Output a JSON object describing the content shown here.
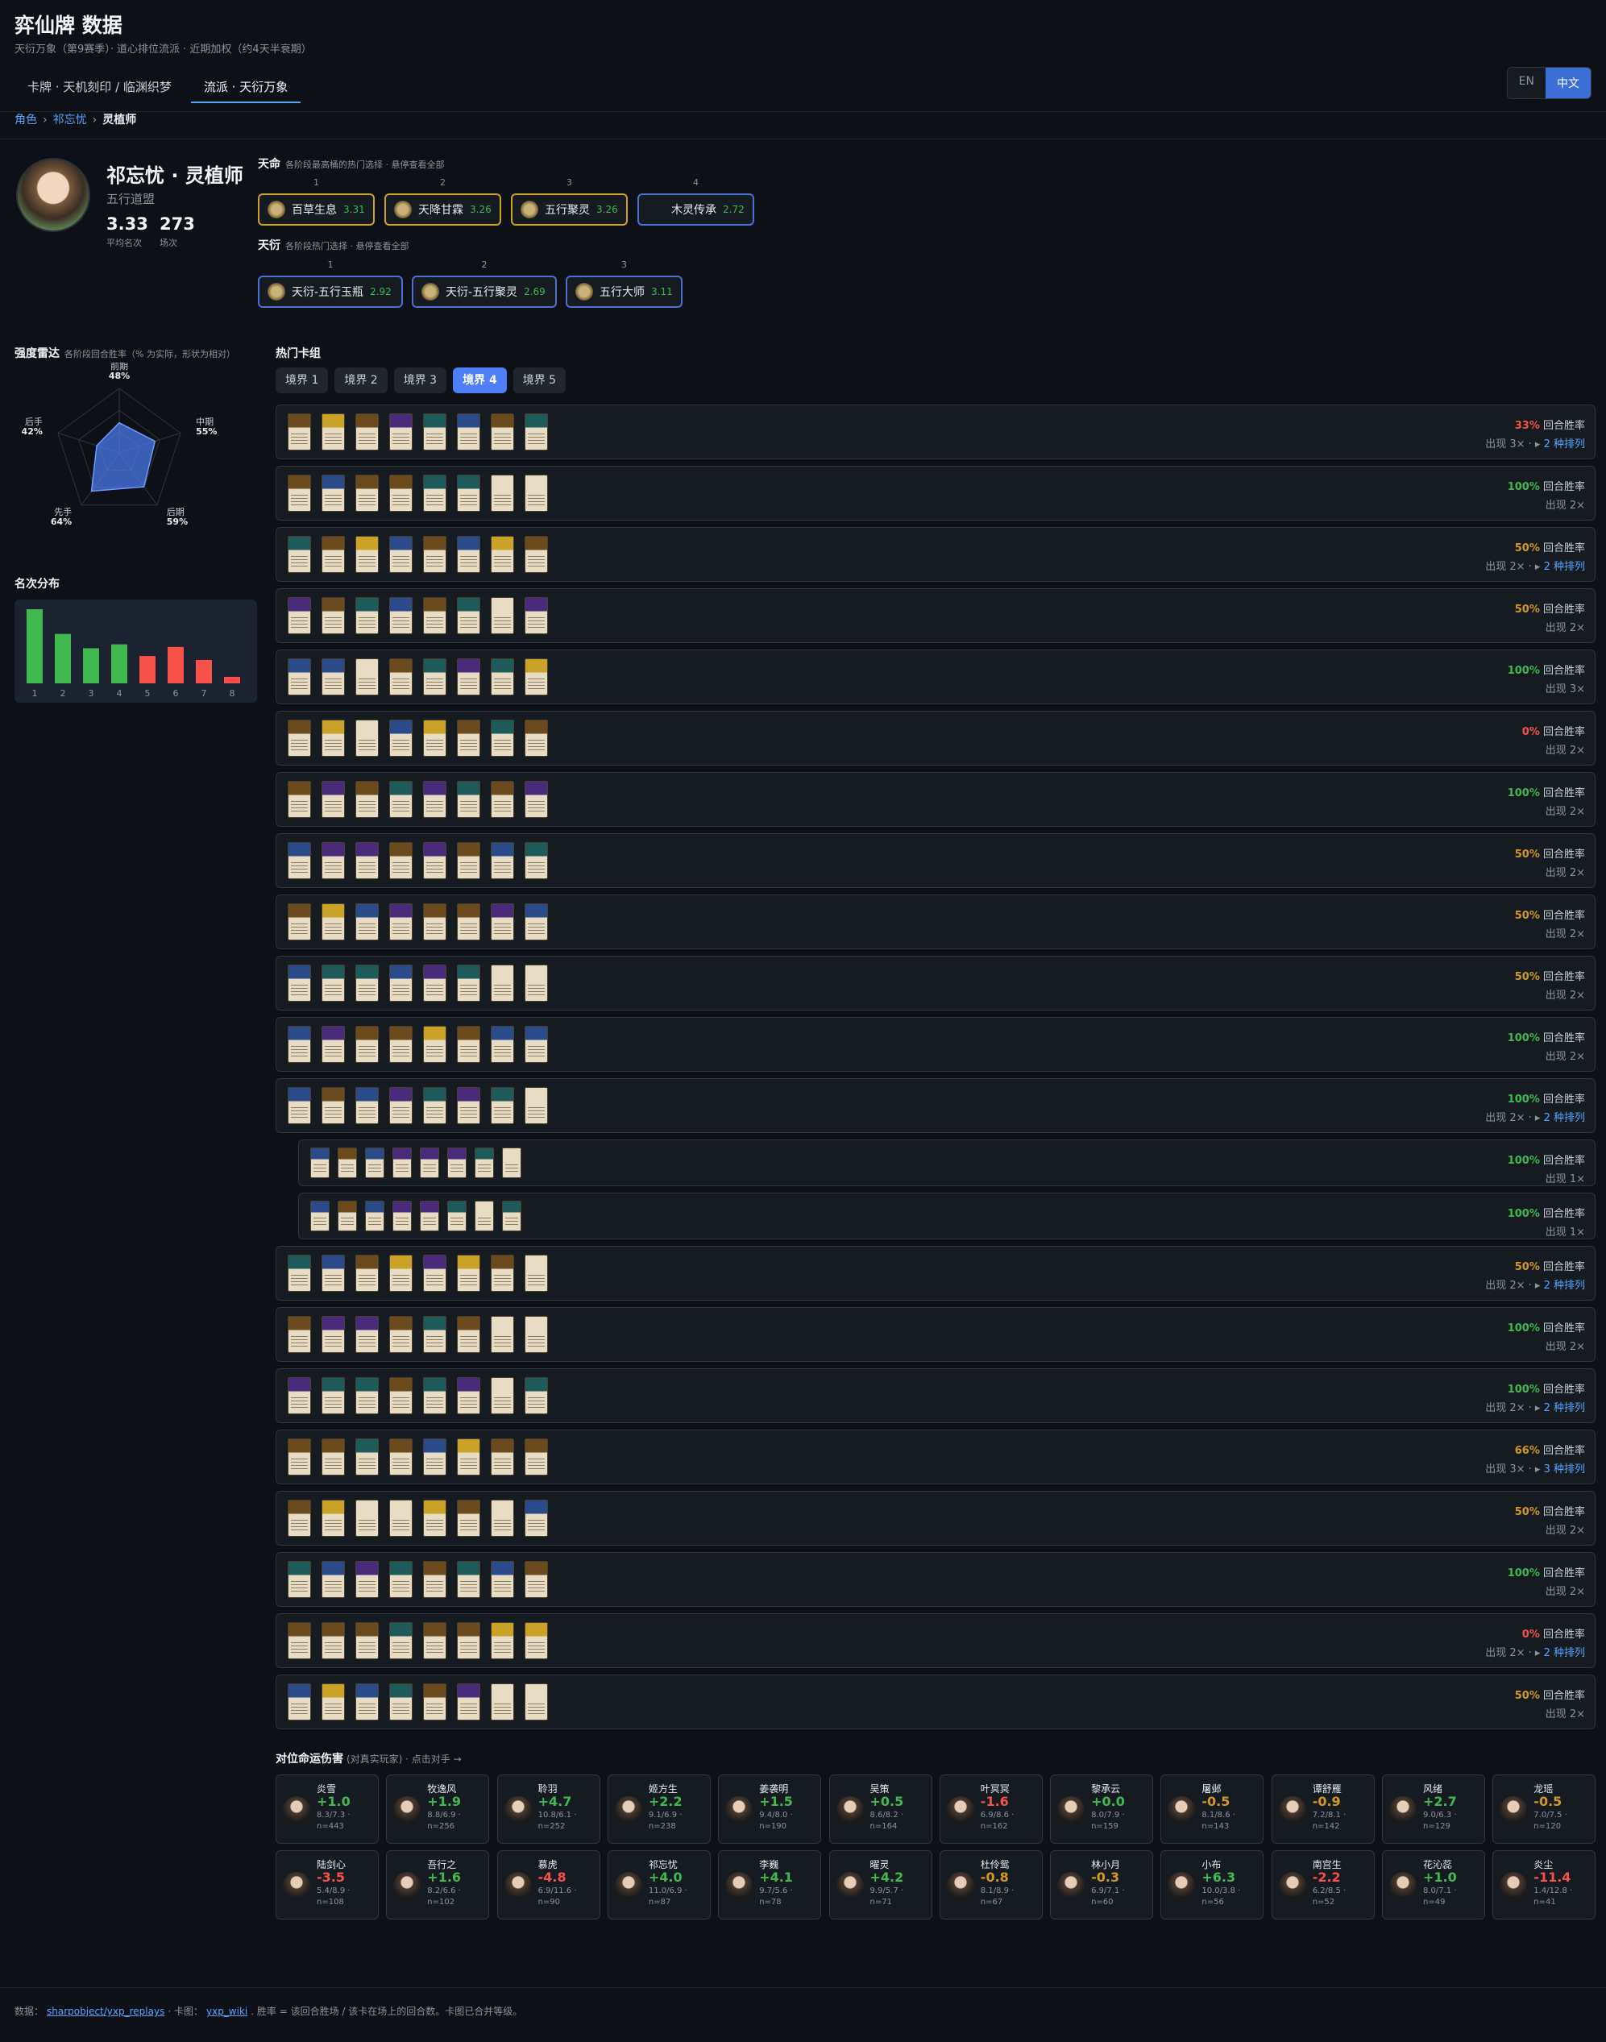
{
  "app": {
    "title": "弈仙牌 数据",
    "subtitle": "天衍万象（第9赛季）· 道心排位流派 · 近期加权（约4天半衰期）"
  },
  "nav": {
    "tabs": [
      "卡牌 · 天机刻印 / 临渊织梦",
      "流派 · 天衍万象"
    ],
    "active_tab": 1,
    "lang": [
      "EN",
      "中文"
    ],
    "lang_active": 1
  },
  "breadcrumb": {
    "root": "角色",
    "parent": "祁忘忧",
    "current": "灵植师"
  },
  "profile": {
    "name": "祁忘忧 · 灵植师",
    "faction": "五行道盟",
    "avg_rank": "3.33",
    "avg_rank_label": "平均名次",
    "games": "273",
    "games_label": "场次"
  },
  "destiny": {
    "title": "天命",
    "note": "各阶段最高桶的热门选择 · 悬停查看全部",
    "items": [
      {
        "rank": "1",
        "name": "百草生息",
        "score": "3.31"
      },
      {
        "rank": "2",
        "name": "天降甘霖",
        "score": "3.26"
      },
      {
        "rank": "3",
        "name": "五行聚灵",
        "score": "3.26"
      },
      {
        "rank": "4",
        "name": "木灵传承",
        "score": "2.72"
      }
    ]
  },
  "tianyan": {
    "title": "天衍",
    "note": "各阶段热门选择 · 悬停查看全部",
    "items": [
      {
        "rank": "1",
        "name": "天衍-五行玉瓶",
        "score": "2.92"
      },
      {
        "rank": "2",
        "name": "天衍-五行聚灵",
        "score": "2.69"
      },
      {
        "rank": "3",
        "name": "五行大师",
        "score": "3.11"
      }
    ]
  },
  "radar": {
    "title": "强度雷达",
    "note": "各阶段回合胜率（% 为实际，形状为相对）",
    "axes": [
      {
        "label": "前期",
        "value": "48%",
        "v": 48
      },
      {
        "label": "中期",
        "value": "55%",
        "v": 55
      },
      {
        "label": "后期",
        "value": "59%",
        "v": 59
      },
      {
        "label": "先手",
        "value": "64%",
        "v": 64
      },
      {
        "label": "后手",
        "value": "42%",
        "v": 42
      }
    ]
  },
  "placement": {
    "title": "名次分布",
    "ranks": [
      "1",
      "2",
      "3",
      "4",
      "5",
      "6",
      "7",
      "8"
    ],
    "values": [
      57,
      38,
      27,
      30,
      21,
      28,
      18,
      5
    ],
    "colors": [
      "#3fb950",
      "#3fb950",
      "#3fb950",
      "#3fb950",
      "#f85149",
      "#f85149",
      "#f85149",
      "#f85149"
    ]
  },
  "decks": {
    "title": "热门卡组",
    "realm_tabs": [
      "境界 1",
      "境界 2",
      "境界 3",
      "境界 4",
      "境界 5"
    ],
    "active_realm": 3,
    "wr_label": "回合胜率",
    "rows": [
      {
        "pct": "33%",
        "tone": "lo",
        "appear": "出现 3×",
        "perm": "2 种排列",
        "cards": [
          1,
          6,
          1,
          3,
          2,
          4,
          1,
          2
        ]
      },
      {
        "pct": "100%",
        "tone": "hi",
        "appear": "出现 2×",
        "perm": "",
        "cards": [
          1,
          4,
          1,
          1,
          2,
          2,
          5,
          5
        ]
      },
      {
        "pct": "50%",
        "tone": "md",
        "appear": "出现 2×",
        "perm": "2 种排列",
        "cards": [
          2,
          1,
          6,
          4,
          1,
          4,
          6,
          1
        ]
      },
      {
        "pct": "50%",
        "tone": "md",
        "appear": "出现 2×",
        "perm": "",
        "cards": [
          3,
          1,
          2,
          4,
          1,
          2,
          5,
          3
        ]
      },
      {
        "pct": "100%",
        "tone": "hi",
        "appear": "出现 3×",
        "perm": "",
        "cards": [
          4,
          4,
          5,
          1,
          2,
          3,
          2,
          6
        ]
      },
      {
        "pct": "0%",
        "tone": "lo",
        "appear": "出现 2×",
        "perm": "",
        "cards": [
          1,
          6,
          5,
          4,
          6,
          1,
          2,
          1
        ]
      },
      {
        "pct": "100%",
        "tone": "hi",
        "appear": "出现 2×",
        "perm": "",
        "cards": [
          1,
          3,
          1,
          2,
          3,
          2,
          1,
          3
        ]
      },
      {
        "pct": "50%",
        "tone": "md",
        "appear": "出现 2×",
        "perm": "",
        "cards": [
          4,
          3,
          3,
          1,
          3,
          1,
          4,
          2
        ]
      },
      {
        "pct": "50%",
        "tone": "md",
        "appear": "出现 2×",
        "perm": "",
        "cards": [
          1,
          6,
          4,
          3,
          1,
          1,
          3,
          4
        ]
      },
      {
        "pct": "50%",
        "tone": "md",
        "appear": "出现 2×",
        "perm": "",
        "cards": [
          4,
          2,
          2,
          4,
          3,
          2,
          5,
          5
        ]
      },
      {
        "pct": "100%",
        "tone": "hi",
        "appear": "出现 2×",
        "perm": "",
        "cards": [
          4,
          3,
          1,
          1,
          6,
          1,
          4,
          4
        ]
      },
      {
        "pct": "100%",
        "tone": "hi",
        "appear": "出现 2×",
        "perm": "2 种排列",
        "cards": [
          4,
          1,
          4,
          3,
          2,
          3,
          2,
          5
        ]
      },
      {
        "pct": "100%",
        "tone": "hi",
        "appear": "出现 1×",
        "perm": "",
        "sub": true,
        "cards": [
          4,
          1,
          4,
          3,
          3,
          3,
          2,
          5
        ]
      },
      {
        "pct": "100%",
        "tone": "hi",
        "appear": "出现 1×",
        "perm": "",
        "sub": true,
        "cards": [
          4,
          1,
          4,
          3,
          3,
          2,
          5,
          2
        ]
      },
      {
        "pct": "50%",
        "tone": "md",
        "appear": "出现 2×",
        "perm": "2 种排列",
        "cards": [
          2,
          4,
          1,
          6,
          3,
          6,
          1,
          5
        ]
      },
      {
        "pct": "100%",
        "tone": "hi",
        "appear": "出现 2×",
        "perm": "",
        "cards": [
          1,
          3,
          3,
          1,
          2,
          1,
          5,
          5
        ]
      },
      {
        "pct": "100%",
        "tone": "hi",
        "appear": "出现 2×",
        "perm": "2 种排列",
        "cards": [
          3,
          2,
          2,
          1,
          2,
          3,
          5,
          2
        ]
      },
      {
        "pct": "66%",
        "tone": "md",
        "appear": "出现 3×",
        "perm": "3 种排列",
        "cards": [
          1,
          1,
          2,
          1,
          4,
          6,
          1,
          1
        ]
      },
      {
        "pct": "50%",
        "tone": "md",
        "appear": "出现 2×",
        "perm": "",
        "cards": [
          1,
          6,
          5,
          5,
          6,
          1,
          5,
          4
        ]
      },
      {
        "pct": "100%",
        "tone": "hi",
        "appear": "出现 2×",
        "perm": "",
        "cards": [
          2,
          4,
          3,
          2,
          1,
          2,
          4,
          1
        ]
      },
      {
        "pct": "0%",
        "tone": "lo",
        "appear": "出现 2×",
        "perm": "2 种排列",
        "cards": [
          1,
          1,
          1,
          2,
          1,
          1,
          6,
          6
        ]
      },
      {
        "pct": "50%",
        "tone": "md",
        "appear": "出现 2×",
        "perm": "",
        "cards": [
          4,
          6,
          4,
          2,
          1,
          3,
          5,
          5
        ]
      }
    ]
  },
  "matchups": {
    "title": "对位命运伤害",
    "note": "(对真实玩家) · 点击对手 →",
    "items": [
      {
        "name": "炎雪",
        "delta": "+1.0",
        "tone": "hi",
        "detail": "8.3/7.3 ·",
        "n": "n=443"
      },
      {
        "name": "牧逸风",
        "delta": "+1.9",
        "tone": "hi",
        "detail": "8.8/6.9 ·",
        "n": "n=256"
      },
      {
        "name": "聆羽",
        "delta": "+4.7",
        "tone": "hi",
        "detail": "10.8/6.1 ·",
        "n": "n=252"
      },
      {
        "name": "姬方生",
        "delta": "+2.2",
        "tone": "hi",
        "detail": "9.1/6.9 ·",
        "n": "n=238"
      },
      {
        "name": "姜袭明",
        "delta": "+1.5",
        "tone": "hi",
        "detail": "9.4/8.0 ·",
        "n": "n=190"
      },
      {
        "name": "吴策",
        "delta": "+0.5",
        "tone": "hi",
        "detail": "8.6/8.2 ·",
        "n": "n=164"
      },
      {
        "name": "叶冥冥",
        "delta": "-1.6",
        "tone": "lo",
        "detail": "6.9/8.6 ·",
        "n": "n=162"
      },
      {
        "name": "黎承云",
        "delta": "+0.0",
        "tone": "hi",
        "detail": "8.0/7.9 ·",
        "n": "n=159"
      },
      {
        "name": "屠邺",
        "delta": "-0.5",
        "tone": "md",
        "detail": "8.1/8.6 ·",
        "n": "n=143"
      },
      {
        "name": "谭舒雁",
        "delta": "-0.9",
        "tone": "md",
        "detail": "7.2/8.1 ·",
        "n": "n=142"
      },
      {
        "name": "风绪",
        "delta": "+2.7",
        "tone": "hi",
        "detail": "9.0/6.3 ·",
        "n": "n=129"
      },
      {
        "name": "龙瑶",
        "delta": "-0.5",
        "tone": "md",
        "detail": "7.0/7.5 ·",
        "n": "n=120"
      },
      {
        "name": "陆剑心",
        "delta": "-3.5",
        "tone": "lo",
        "detail": "5.4/8.9 ·",
        "n": "n=108"
      },
      {
        "name": "吾行之",
        "delta": "+1.6",
        "tone": "hi",
        "detail": "8.2/6.6 ·",
        "n": "n=102"
      },
      {
        "name": "慕虎",
        "delta": "-4.8",
        "tone": "lo",
        "detail": "6.9/11.6 ·",
        "n": "n=90"
      },
      {
        "name": "祁忘忧",
        "delta": "+4.0",
        "tone": "hi",
        "detail": "11.0/6.9 ·",
        "n": "n=87"
      },
      {
        "name": "李巍",
        "delta": "+4.1",
        "tone": "hi",
        "detail": "9.7/5.6 ·",
        "n": "n=78"
      },
      {
        "name": "曜灵",
        "delta": "+4.2",
        "tone": "hi",
        "detail": "9.9/5.7 ·",
        "n": "n=71"
      },
      {
        "name": "杜伶鸳",
        "delta": "-0.8",
        "tone": "md",
        "detail": "8.1/8.9 ·",
        "n": "n=67"
      },
      {
        "name": "林小月",
        "delta": "-0.3",
        "tone": "md",
        "detail": "6.9/7.1 ·",
        "n": "n=60"
      },
      {
        "name": "小布",
        "delta": "+6.3",
        "tone": "hi",
        "detail": "10.0/3.8 ·",
        "n": "n=56"
      },
      {
        "name": "南宫生",
        "delta": "-2.2",
        "tone": "lo",
        "detail": "6.2/8.5 ·",
        "n": "n=52"
      },
      {
        "name": "花沁蕊",
        "delta": "+1.0",
        "tone": "hi",
        "detail": "8.0/7.1 ·",
        "n": "n=49"
      },
      {
        "name": "炎尘",
        "delta": "-11.4",
        "tone": "lo",
        "detail": "1.4/12.8 ·",
        "n": "n=41"
      }
    ]
  },
  "footer": {
    "prefix": "数据：",
    "src_link": "sharpobject/yxp_replays",
    "mid": "· 卡图：",
    "wiki_link": "yxp_wiki",
    "suffix": ". 胜率 = 该回合胜场 / 该卡在场上的回合数。卡图已合并等级。"
  }
}
